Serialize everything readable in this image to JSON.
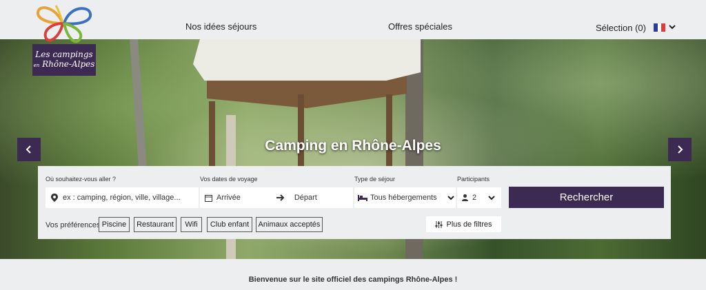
{
  "header": {
    "logo_line1": "Les campings",
    "logo_line2_small": "en",
    "logo_line2": "Rhône-Alpes",
    "nav": [
      "Nos idées séjours",
      "Offres spéciales"
    ],
    "selection": "Sélection (0)",
    "lang_flag_colors": [
      "#2b3f9a",
      "#ffffff",
      "#e43a3a"
    ],
    "lang_icon": "chevron-down-icon"
  },
  "hero": {
    "title": "Camping en Rhône-Alpes",
    "prev_icon": "chevron-left-icon",
    "next_icon": "chevron-right-icon"
  },
  "search": {
    "destination_label": "Où souhaitez-vous aller ?",
    "destination_placeholder": "ex : camping, région, ville, village...",
    "dates_label": "Vos dates de voyage",
    "arrival": "Arrivée",
    "departure": "Départ",
    "stay_type_label": "Type de séjour",
    "stay_type_value": "Tous hébergements",
    "participants_label": "Participants",
    "participants_value": "2",
    "submit": "Rechercher",
    "preferences_label": "Vos préférences :",
    "preferences": [
      "Piscine",
      "Restaurant",
      "Wifi",
      "Club enfant",
      "Animaux acceptés"
    ],
    "more_filters": "Plus de filtres"
  },
  "welcome": "Bienvenue sur le site officiel des campings Rhône-Alpes !",
  "colors": {
    "brand": "#3d2a52",
    "background": "#eceef0"
  }
}
